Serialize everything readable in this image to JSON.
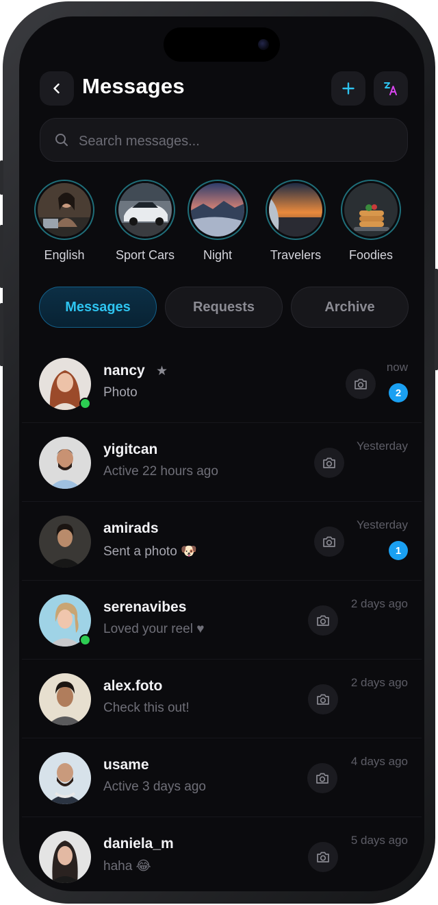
{
  "header": {
    "title": "Messages",
    "back_icon": "chevron-left-icon",
    "new_icon": "plus-icon",
    "translate_icon": "translate-icon",
    "accent_color": "#2ec4f0"
  },
  "search": {
    "placeholder": "Search messages...",
    "value": ""
  },
  "stories": [
    {
      "label": "English"
    },
    {
      "label": "Sport Cars"
    },
    {
      "label": "Night"
    },
    {
      "label": "Travelers"
    },
    {
      "label": "Foodies"
    }
  ],
  "tabs": [
    {
      "label": "Messages",
      "active": true
    },
    {
      "label": "Requests",
      "active": false
    },
    {
      "label": "Archive",
      "active": false
    }
  ],
  "conversations": [
    {
      "name": "nancy",
      "starred": true,
      "preview": "Photo",
      "time": "now",
      "unread": "2",
      "online": true
    },
    {
      "name": "yigitcan",
      "starred": false,
      "preview": "Active 22 hours ago",
      "time": "Yesterday",
      "unread": "",
      "online": false
    },
    {
      "name": "amirads",
      "starred": false,
      "preview": "Sent a photo 🐶",
      "time": "Yesterday",
      "unread": "1",
      "online": false
    },
    {
      "name": "serenavibes",
      "starred": false,
      "preview": "Loved your reel ♥",
      "time": "2 days ago",
      "unread": "",
      "online": true
    },
    {
      "name": "alex.foto",
      "starred": false,
      "preview": "Check this out!",
      "time": "2 days ago",
      "unread": "",
      "online": false
    },
    {
      "name": "usame",
      "starred": false,
      "preview": "Active 3 days ago",
      "time": "4 days ago",
      "unread": "",
      "online": false
    },
    {
      "name": "daniela_m",
      "starred": false,
      "preview": "haha 😂",
      "time": "5 days ago",
      "unread": "",
      "online": false
    }
  ],
  "colors": {
    "badge": "#1aa0f2",
    "online": "#2ccd52",
    "story_ring": "#1f6f7a",
    "background": "#0b0b0e"
  }
}
